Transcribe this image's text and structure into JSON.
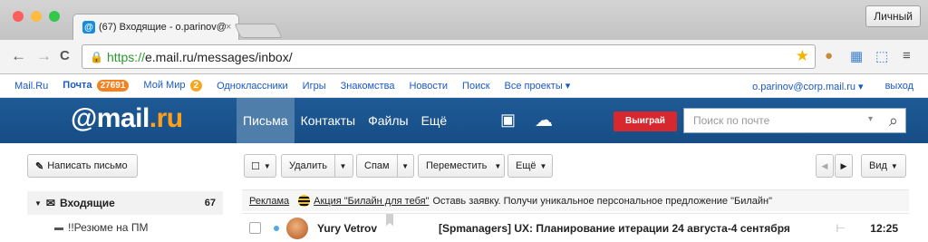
{
  "browser": {
    "tab_title": "(67) Входящие - o.parinov@",
    "tab_close": "×",
    "personal_button": "Личный",
    "url_scheme": "https://",
    "url_rest": "e.mail.ru/messages/inbox/",
    "back": "←",
    "forward": "→",
    "reload": "C",
    "star": "★"
  },
  "portal_bar": {
    "links": [
      "Mail.Ru",
      "Почта",
      "Мой Мир",
      "Одноклассники",
      "Игры",
      "Знакомства",
      "Новости",
      "Поиск",
      "Все проекты ▾"
    ],
    "mail_badge": "27691",
    "mir_badge": "2",
    "account": "o.parinov@corp.mail.ru ▾",
    "logout": "выход",
    "colors": {
      "mail_badge": "#f58220",
      "mir_badge": "#f5a623"
    }
  },
  "header": {
    "logo_main": "@mail",
    "logo_ru": ".ru",
    "nav": [
      "Письма",
      "Контакты",
      "Файлы",
      "Ещё"
    ],
    "win_button": "Выиграй",
    "search_placeholder": "Поиск по почте"
  },
  "toolbar": {
    "compose": "Написать письмо",
    "delete": "Удалить",
    "spam": "Спам",
    "move": "Переместить",
    "more": "Ещё",
    "view": "Вид"
  },
  "sidebar": {
    "inbox": "Входящие",
    "inbox_count": "67",
    "subfolder": "!!Резюме на ПМ"
  },
  "promo": {
    "ad_label": "Реклама",
    "link": "Акция \"Билайн для тебя\"",
    "text": "Оставь заявку. Получи уникальное персональное предложение \"Билайн\""
  },
  "messages": [
    {
      "sender": "Yury Vetrov",
      "subject": "[Spmanagers] UX: Планирование итерации 24 августа-4 сентября",
      "time": "12:25"
    }
  ]
}
